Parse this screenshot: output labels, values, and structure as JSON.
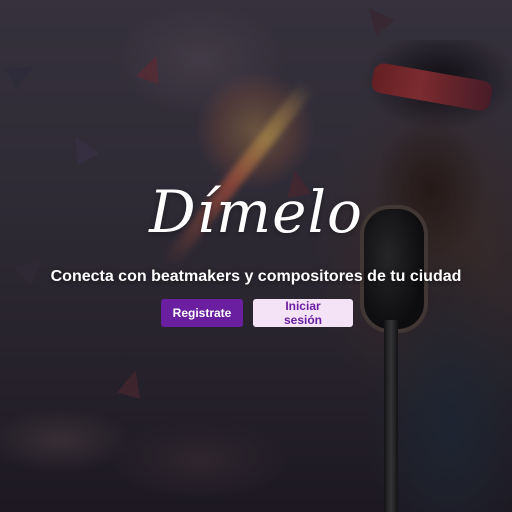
{
  "hero": {
    "logo_text": "Dímelo",
    "tagline": "Conecta con beatmakers y compositores de tu ciudad",
    "register_label": "Registrate",
    "login_label": "Iniciar sesión"
  },
  "colors": {
    "primary": "#6a1fa0",
    "secondary_bg": "#f4e2f7",
    "text": "#ffffff"
  }
}
